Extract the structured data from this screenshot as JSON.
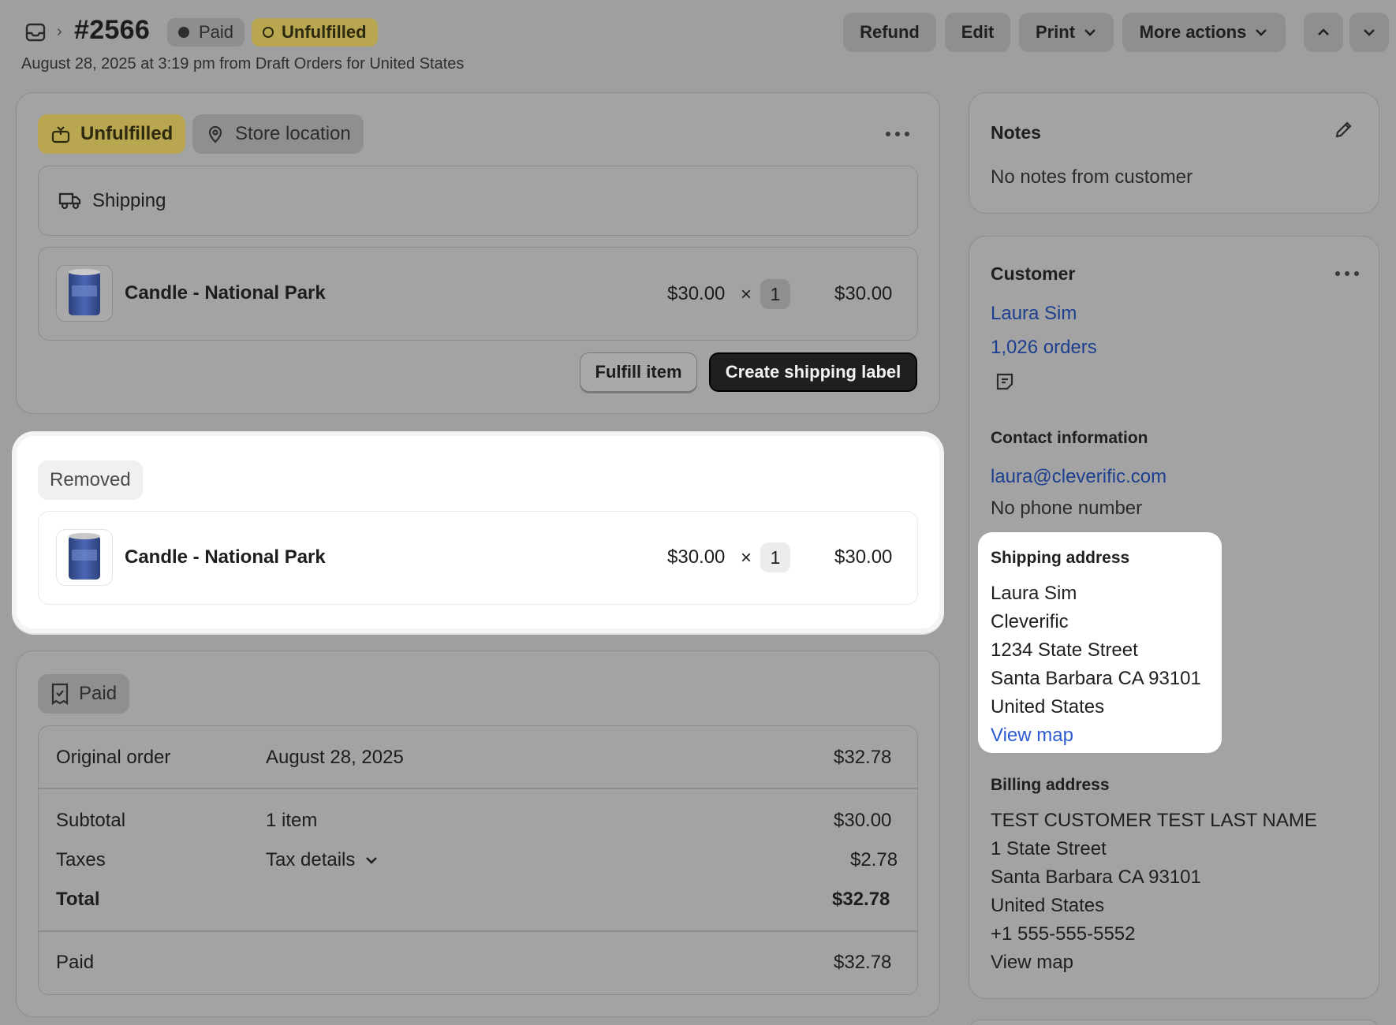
{
  "header": {
    "order_number": "#2566",
    "payment_badge": "Paid",
    "fulfillment_badge": "Unfulfilled",
    "subline": "August 28, 2025 at 3:19 pm from Draft Orders for United States",
    "buttons": {
      "refund": "Refund",
      "edit": "Edit",
      "print": "Print",
      "more_actions": "More actions"
    }
  },
  "fulfillment_card": {
    "status_tag": "Unfulfilled",
    "location_tag": "Store location",
    "delivery_method": "Shipping",
    "item": {
      "name": "Candle - National Park",
      "unit_price": "$30.00",
      "times": "×",
      "quantity": "1",
      "total": "$30.00"
    },
    "fulfill_button": "Fulfill item",
    "create_label_button": "Create shipping label"
  },
  "removed_card": {
    "tag": "Removed",
    "item": {
      "name": "Candle - National Park",
      "unit_price": "$30.00",
      "times": "×",
      "quantity": "1",
      "total": "$30.00"
    }
  },
  "payment_card": {
    "tag": "Paid",
    "original_order": {
      "label": "Original order",
      "date": "August 28, 2025",
      "amount": "$32.78"
    },
    "subtotal": {
      "label": "Subtotal",
      "detail": "1 item",
      "amount": "$30.00"
    },
    "taxes": {
      "label": "Taxes",
      "detail": "Tax details",
      "amount": "$2.78"
    },
    "total": {
      "label": "Total",
      "amount": "$32.78"
    },
    "paid": {
      "label": "Paid",
      "amount": "$32.78"
    }
  },
  "notes": {
    "title": "Notes",
    "text": "No notes from customer"
  },
  "customer": {
    "title": "Customer",
    "name": "Laura Sim",
    "orders": "1,026 orders",
    "contact_title": "Contact information",
    "email": "laura@cleverific.com",
    "phone": "No phone number",
    "shipping": {
      "title": "Shipping address",
      "lines": [
        "Laura Sim",
        "Cleverific",
        "1234 State Street",
        "Santa Barbara CA 93101",
        "United States"
      ],
      "map_link": "View map"
    },
    "billing": {
      "title": "Billing address",
      "lines": [
        "TEST CUSTOMER TEST LAST NAME",
        "1 State Street",
        "Santa Barbara CA 93101",
        "United States",
        "+1 555-555-5552"
      ],
      "map_link": "View map"
    }
  },
  "colors": {
    "page_dim": "#9f9f9f",
    "unfulfilled_badge": "#b8a650",
    "primary_button": "#1f1f1f",
    "link": "#1d3f8f",
    "highlight": "#ffffff"
  }
}
